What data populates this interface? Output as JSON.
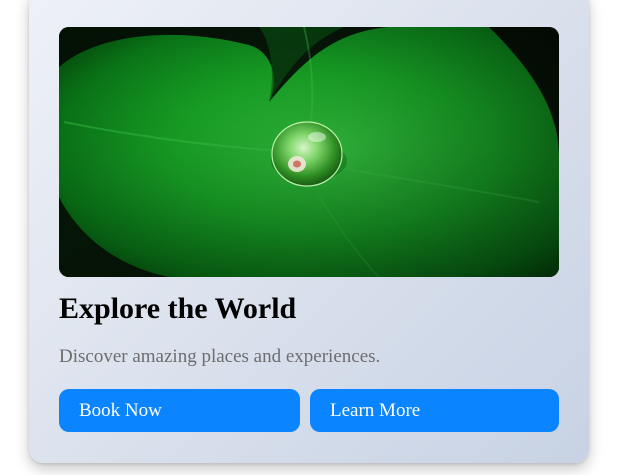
{
  "card": {
    "image": {
      "subject": "water droplet on a green leaf"
    },
    "title": "Explore the World",
    "description": "Discover amazing places and experiences.",
    "buttons": {
      "primary_label": "Book Now",
      "secondary_label": "Learn More"
    }
  },
  "colors": {
    "button_bg": "#0a84ff",
    "button_text": "#ffffff",
    "title_text": "#000000",
    "description_text": "#6d6d6d",
    "leaf_green": "#1fbf2e"
  }
}
